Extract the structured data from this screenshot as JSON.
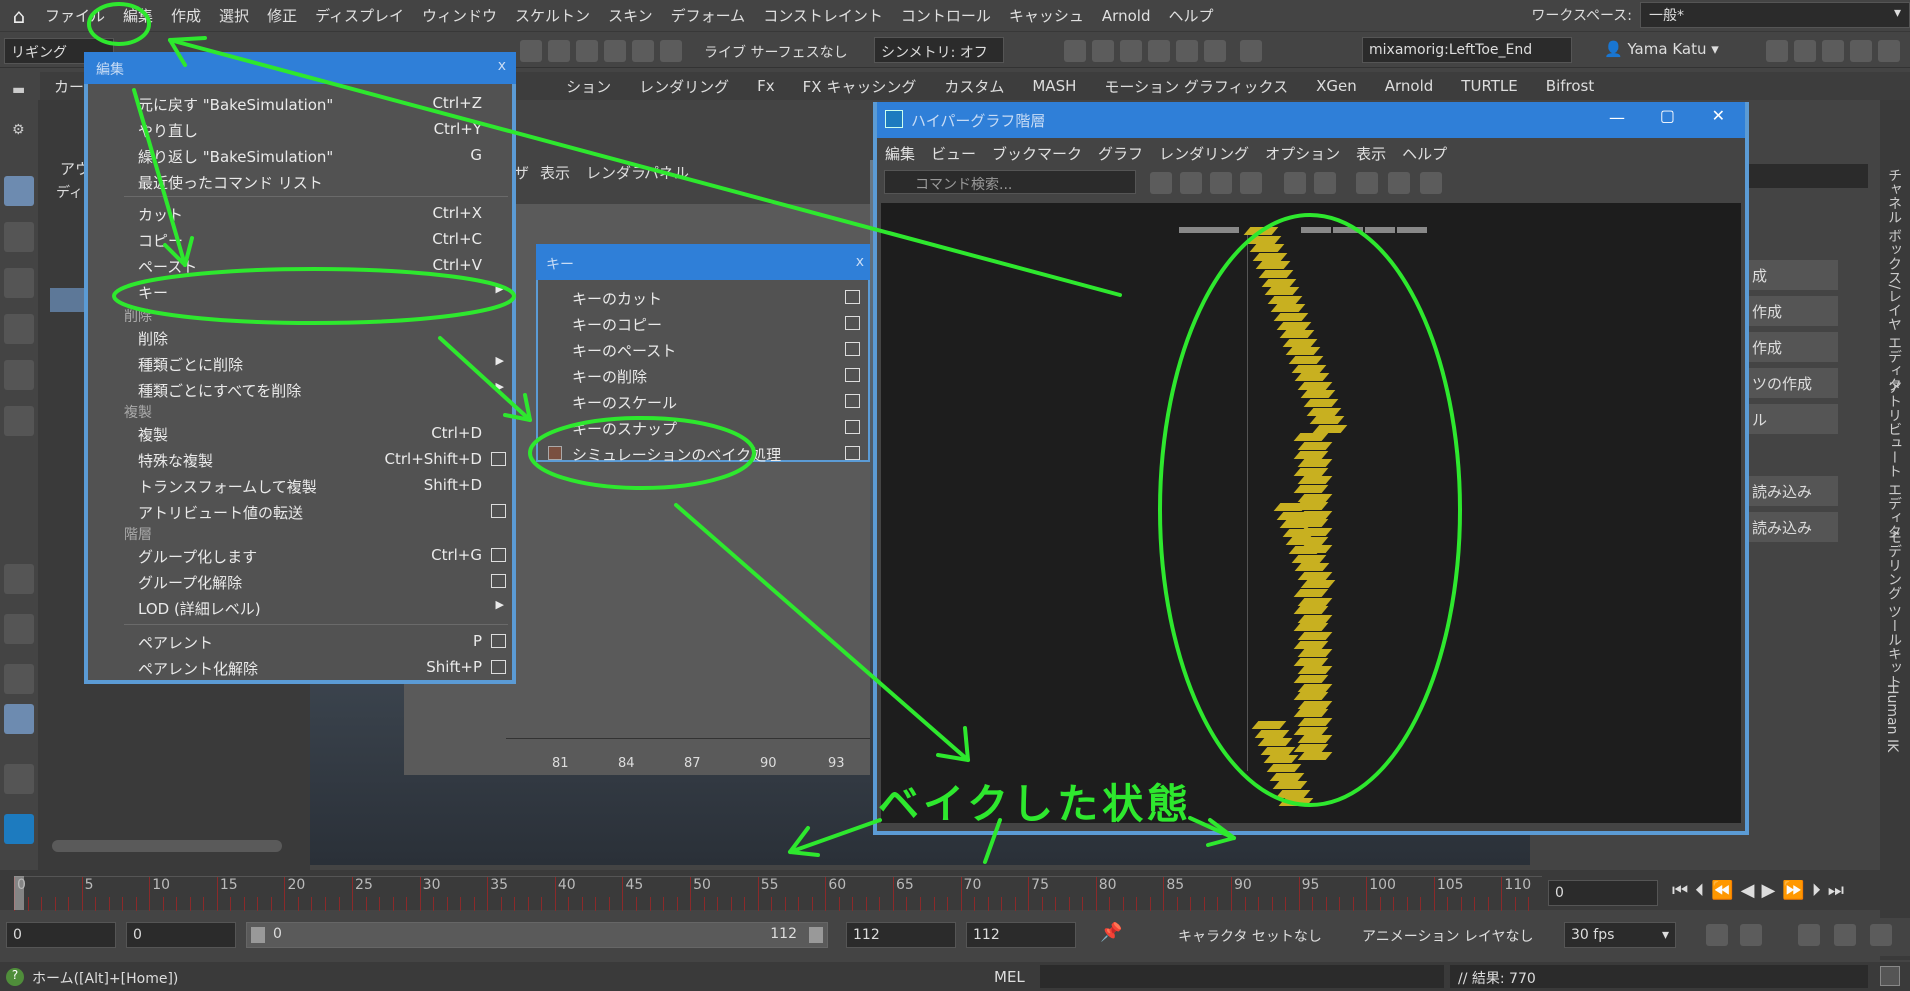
{
  "menubar": {
    "items": [
      "ファイル",
      "編集",
      "作成",
      "選択",
      "修正",
      "ディスプレイ",
      "ウィンドウ",
      "スケルトン",
      "スキン",
      "デフォーム",
      "コンストレイント",
      "コントロール",
      "キャッシュ",
      "Arnold",
      "ヘルプ"
    ],
    "workspace_label": "ワークスペース:",
    "workspace_value": "一般*"
  },
  "status": {
    "mode": "リギング",
    "live_surface": "ライブ サーフェスなし",
    "symmetry": "シンメトリ: オフ",
    "object_name": "mixamorig:LeftToe_End",
    "user": "Yama Katu"
  },
  "shelf_tabs": [
    "カーブ",
    "ション",
    "レンダリング",
    "Fx",
    "FX キャッシング",
    "カスタム",
    "MASH",
    "モーション グラフィックス",
    "XGen",
    "Arnold",
    "TURTLE",
    "Bifrost"
  ],
  "outliner": {
    "label1": "アウ",
    "label2": "ディ"
  },
  "graph_menu": [
    "ザ",
    "表示",
    "レンダラ",
    "パネル"
  ],
  "graph_ticks": [
    "81",
    "84",
    "87",
    "90",
    "93"
  ],
  "edit_menu": {
    "title": "編集",
    "close": "x",
    "undo": {
      "label": "元に戻す \"BakeSimulation\"",
      "shortcut": "Ctrl+Z"
    },
    "redo": {
      "label": "やり直し",
      "shortcut": "Ctrl+Y"
    },
    "repeat": {
      "label": "繰り返し \"BakeSimulation\"",
      "shortcut": "G"
    },
    "recent": {
      "label": "最近使ったコマンド リスト"
    },
    "cut": {
      "label": "カット",
      "shortcut": "Ctrl+X"
    },
    "copy": {
      "label": "コピー",
      "shortcut": "Ctrl+C"
    },
    "paste": {
      "label": "ペースト",
      "shortcut": "Ctrl+V"
    },
    "keys": {
      "label": "キー"
    },
    "sec_delete": "削除",
    "delete": {
      "label": "削除"
    },
    "delete_by_type": {
      "label": "種類ごとに削除"
    },
    "delete_all_by_type": {
      "label": "種類ごとにすべてを削除"
    },
    "sec_duplicate": "複製",
    "duplicate": {
      "label": "複製",
      "shortcut": "Ctrl+D"
    },
    "duplicate_special": {
      "label": "特殊な複製",
      "shortcut": "Ctrl+Shift+D"
    },
    "duplicate_transform": {
      "label": "トランスフォームして複製",
      "shortcut": "Shift+D"
    },
    "transfer_attr": {
      "label": "アトリビュート値の転送"
    },
    "sec_hierarchy": "階層",
    "group": {
      "label": "グループ化します",
      "shortcut": "Ctrl+G"
    },
    "ungroup": {
      "label": "グループ化解除"
    },
    "lod": {
      "label": "LOD (詳細レベル)"
    },
    "parent": {
      "label": "ペアレント",
      "shortcut": "P"
    },
    "unparent": {
      "label": "ペアレント化解除",
      "shortcut": "Shift+P"
    }
  },
  "key_menu": {
    "title": "キー",
    "close": "x",
    "items": [
      "キーのカット",
      "キーのコピー",
      "キーのペースト",
      "キーの削除",
      "キーのスケール",
      "キーのスナップ",
      "シミュレーションのベイク処理"
    ]
  },
  "hypergraph": {
    "title": "ハイパーグラフ階層",
    "menu": [
      "編集",
      "ビュー",
      "ブックマーク",
      "グラフ",
      "レンダリング",
      "オプション",
      "表示",
      "ヘルプ"
    ],
    "search_placeholder": "コマンド検索..."
  },
  "right_panel": {
    "items": [
      "成",
      "作成",
      "作成",
      "ツの作成",
      "ル",
      "読み込み",
      "読み込み"
    ]
  },
  "vertical_tabs": [
    "チャネル ボックス/レイヤ エディタ",
    "アトリビュート エディタ",
    "モデリング ツールキット",
    "Human IK"
  ],
  "timeline": {
    "ticks": [
      "0",
      "5",
      "10",
      "15",
      "20",
      "25",
      "30",
      "35",
      "40",
      "45",
      "50",
      "55",
      "60",
      "65",
      "70",
      "75",
      "80",
      "85",
      "90",
      "95",
      "100",
      "105",
      "110"
    ],
    "current_frame": "0"
  },
  "range": {
    "start": "0",
    "anim_start": "0",
    "slider_start": "0",
    "slider_end": "112",
    "end": "112",
    "anim_end": "112",
    "character_set": "キャラクタ セットなし",
    "anim_layer": "アニメーション レイヤなし",
    "fps": "30 fps"
  },
  "command_line": {
    "help": "ホーム([Alt]+[Home])",
    "lang": "MEL",
    "result": "// 結果: 770"
  },
  "annotation": "ベイクした状態",
  "colors": {
    "accent": "#2f7fd8",
    "annotation": "#2ee82e",
    "node": "#c8b020"
  }
}
